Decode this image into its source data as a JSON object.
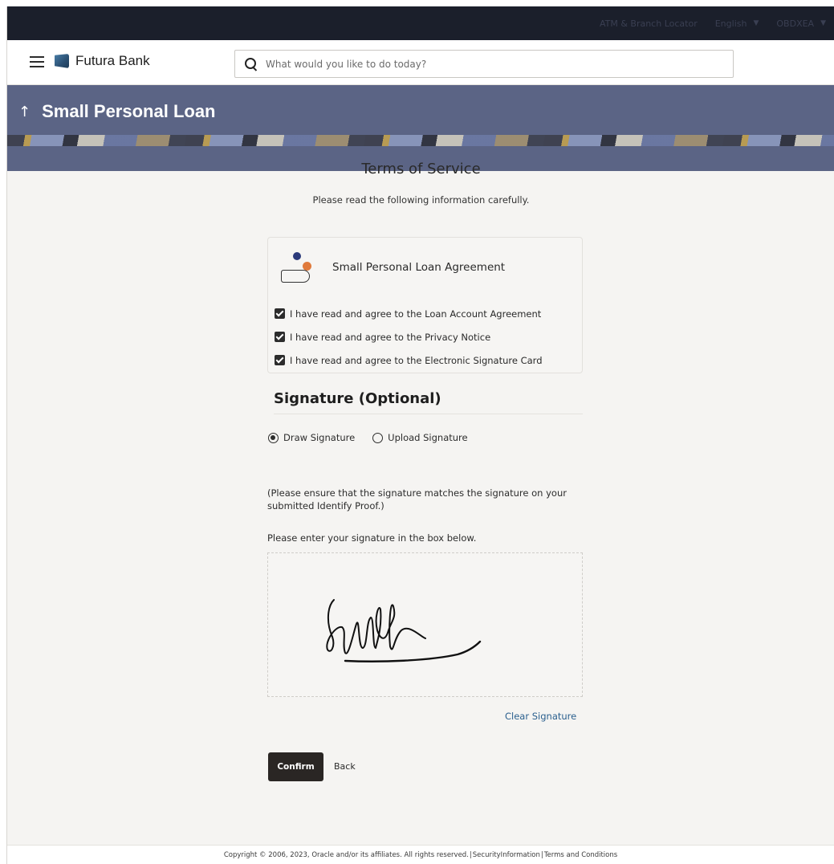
{
  "topbar": {
    "branch": "ATM & Branch Locator",
    "language": "English",
    "user": "OBDXEA"
  },
  "header": {
    "brand": "Futura Bank",
    "search_placeholder": "What would you like to do today?"
  },
  "banner": {
    "title": "Small Personal Loan"
  },
  "terms": {
    "title": "Terms of Service",
    "subtitle": "Please read the following information carefully.",
    "card_title": "Small Personal Loan Agreement",
    "checks": [
      "I have read and agree to the Loan Account Agreement",
      "I have read and agree to the Privacy Notice",
      "I have read and agree to the Electronic Signature Card"
    ]
  },
  "signature": {
    "heading": "Signature (Optional)",
    "options": [
      "Draw Signature",
      "Upload Signature"
    ],
    "selected": "Draw Signature",
    "note": "(Please ensure that the signature matches the signature on your submitted Identify Proof.)",
    "instruction": "Please enter your signature in the box below.",
    "clear_label": "Clear Signature"
  },
  "actions": {
    "confirm": "Confirm",
    "back": "Back"
  },
  "footer": {
    "copyright": "Copyright © 2006, 2023, Oracle and/or its affiliates. All rights reserved.",
    "security": "SecurityInformation",
    "terms": "Terms and Conditions"
  }
}
